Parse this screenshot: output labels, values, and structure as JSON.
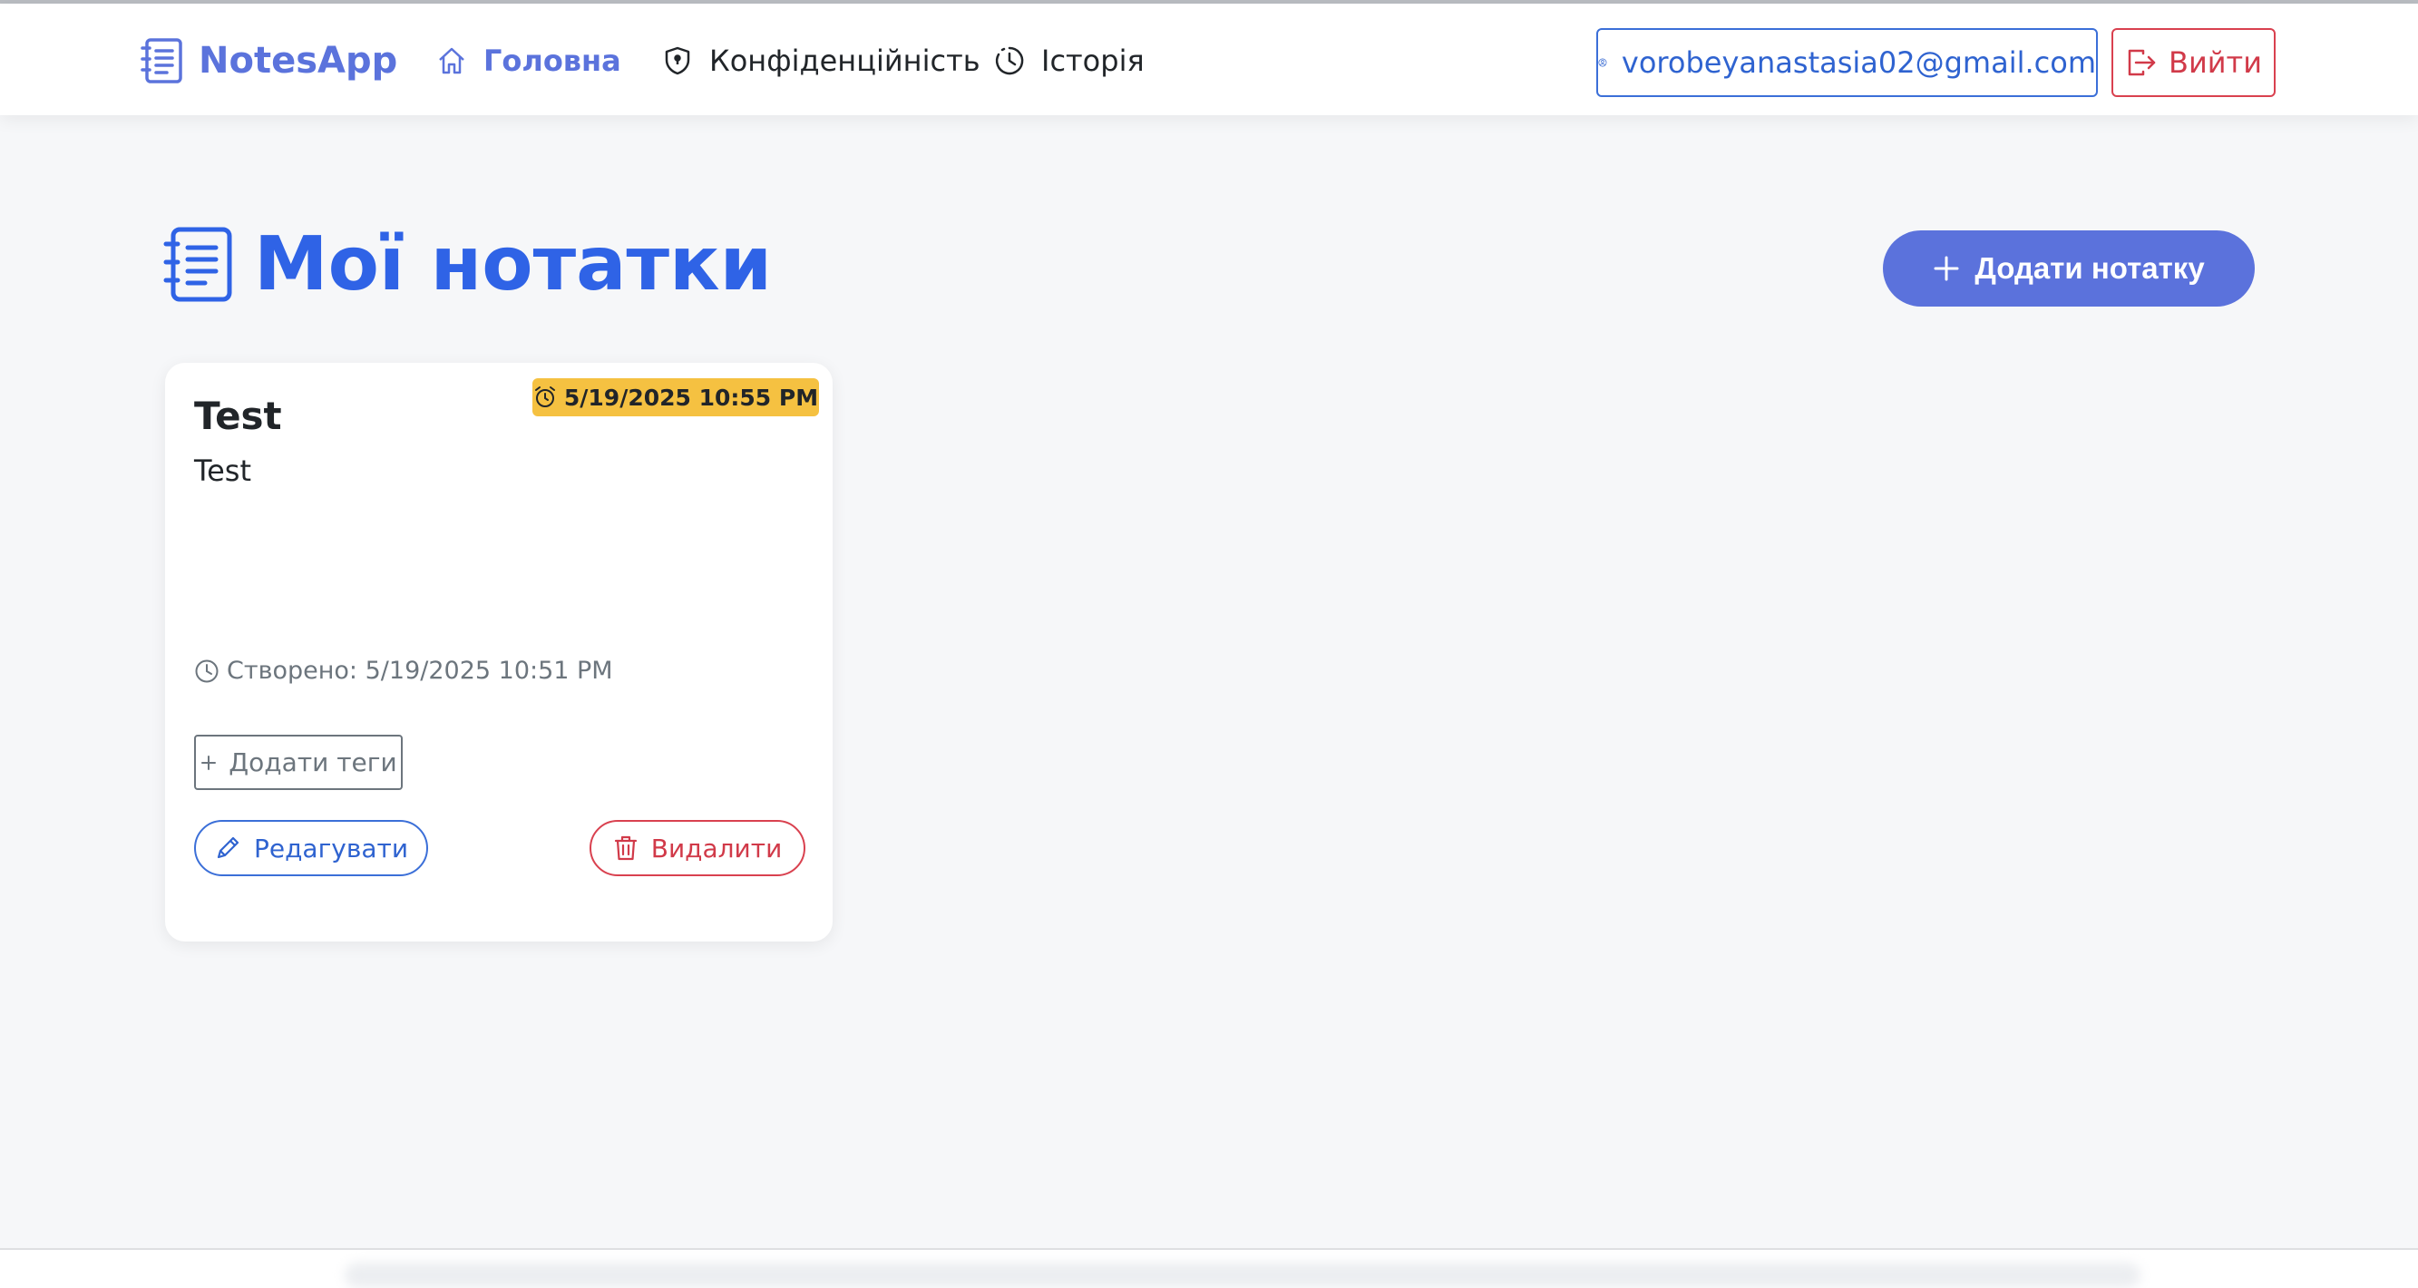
{
  "navbar": {
    "brand": "NotesApp",
    "links": [
      {
        "label": "Головна",
        "icon": "home-icon",
        "active": true
      },
      {
        "label": "Конфіденційність",
        "icon": "shield-icon",
        "active": false
      },
      {
        "label": "Історія",
        "icon": "clock-icon",
        "active": false
      }
    ],
    "user_email": "vorobeyanastasia02@gmail.com",
    "logout_label": "Вийти"
  },
  "main": {
    "title": "Мої нотатки",
    "add_note_label": "Додати нотатку",
    "notes": [
      {
        "title": "Test",
        "reminder": "5/19/2025 10:55 PM",
        "body": "Test",
        "created": "Створено: 5/19/2025 10:51 PM",
        "add_tags_label": "Додати теги",
        "edit_label": "Редагувати",
        "delete_label": "Видалити"
      }
    ]
  },
  "colors": {
    "brand": "#5b73dc",
    "title": "#2f63e6",
    "primary_button": "#5b72dc",
    "danger": "#d13a49",
    "reminder_badge": "#f5c141",
    "background": "#f6f7f9"
  }
}
